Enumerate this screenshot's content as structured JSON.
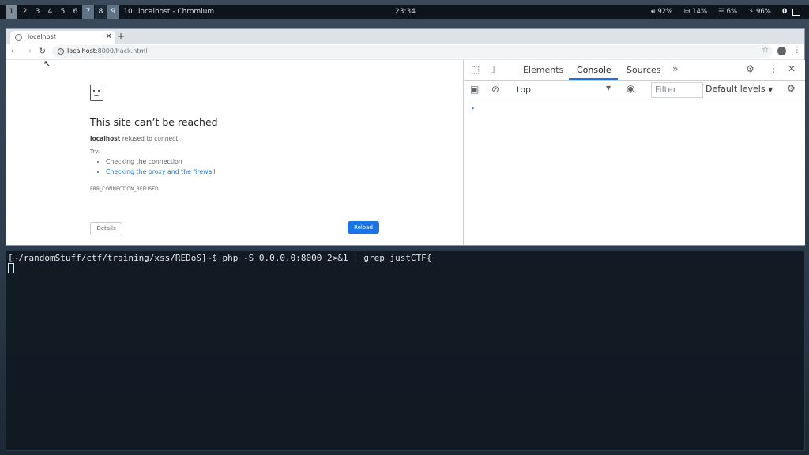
{
  "topbar": {
    "workspaces": [
      "1",
      "2",
      "3",
      "4",
      "5",
      "6",
      "7",
      "8",
      "9",
      "10"
    ],
    "window_title": "localhost - Chromium",
    "clock": "23:34",
    "volume": "92%",
    "disk": "14%",
    "memory": "6%",
    "battery": "96%",
    "tray_label": "0"
  },
  "browser": {
    "tab_title": "localhost",
    "url_host": "localhost",
    "url_rest": ":8000/hack.html"
  },
  "error_page": {
    "title": "This site can’t be reached",
    "host": "localhost",
    "desc_rest": " refused to connect.",
    "try_label": "Try:",
    "suggestions": [
      "Checking the connection",
      "Checking the proxy and the firewall"
    ],
    "error_code": "ERR_CONNECTION_REFUSED",
    "details_label": "Details",
    "reload_label": "Reload"
  },
  "devtools": {
    "tabs": [
      "Elements",
      "Console",
      "Sources"
    ],
    "active_tab": "Console",
    "context": "top",
    "filter_placeholder": "Filter",
    "levels": "Default levels",
    "prompt": "›"
  },
  "terminal": {
    "line": "[~/randomStuff/ctf/training/xss/REDoS]~$ php -S 0.0.0.0:8000 2>&1 | grep justCTF{"
  },
  "colors": {
    "accent": "#1a73e8",
    "topbar": "#0e141b"
  }
}
